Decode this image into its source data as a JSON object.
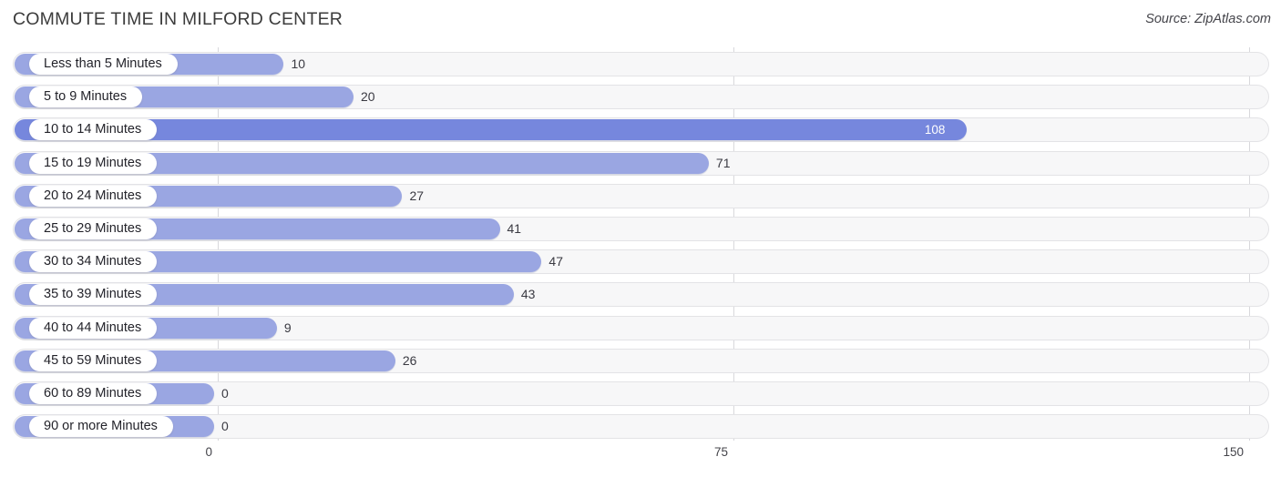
{
  "header": {
    "title": "COMMUTE TIME IN MILFORD CENTER",
    "source": "Source: ZipAtlas.com"
  },
  "colors": {
    "bar": "#9aa6e2",
    "bar_max": "#7687dd",
    "track": "#f7f7f8",
    "track_border": "#e3e3e6",
    "gridline": "#d8d8dc",
    "label_pill": "#ffffff",
    "text": "#23232a",
    "value_inside": "#ffffff"
  },
  "chart_data": {
    "type": "bar",
    "orientation": "horizontal",
    "title": "COMMUTE TIME IN MILFORD CENTER",
    "subtitle": "",
    "xlabel": "",
    "ylabel": "",
    "xlim": [
      0,
      150
    ],
    "xticks": [
      0,
      75,
      150
    ],
    "xtick_labels": [
      "0",
      "75",
      "150"
    ],
    "grid": true,
    "legend": null,
    "source": "Source: ZipAtlas.com",
    "categories": [
      "Less than 5 Minutes",
      "5 to 9 Minutes",
      "10 to 14 Minutes",
      "15 to 19 Minutes",
      "20 to 24 Minutes",
      "25 to 29 Minutes",
      "30 to 34 Minutes",
      "35 to 39 Minutes",
      "40 to 44 Minutes",
      "45 to 59 Minutes",
      "60 to 89 Minutes",
      "90 or more Minutes"
    ],
    "values": [
      10,
      20,
      108,
      71,
      27,
      41,
      47,
      43,
      9,
      26,
      0,
      0
    ],
    "value_labels": [
      "10",
      "20",
      "108",
      "71",
      "27",
      "41",
      "47",
      "43",
      "9",
      "26",
      "0",
      "0"
    ],
    "max_index": 2
  }
}
